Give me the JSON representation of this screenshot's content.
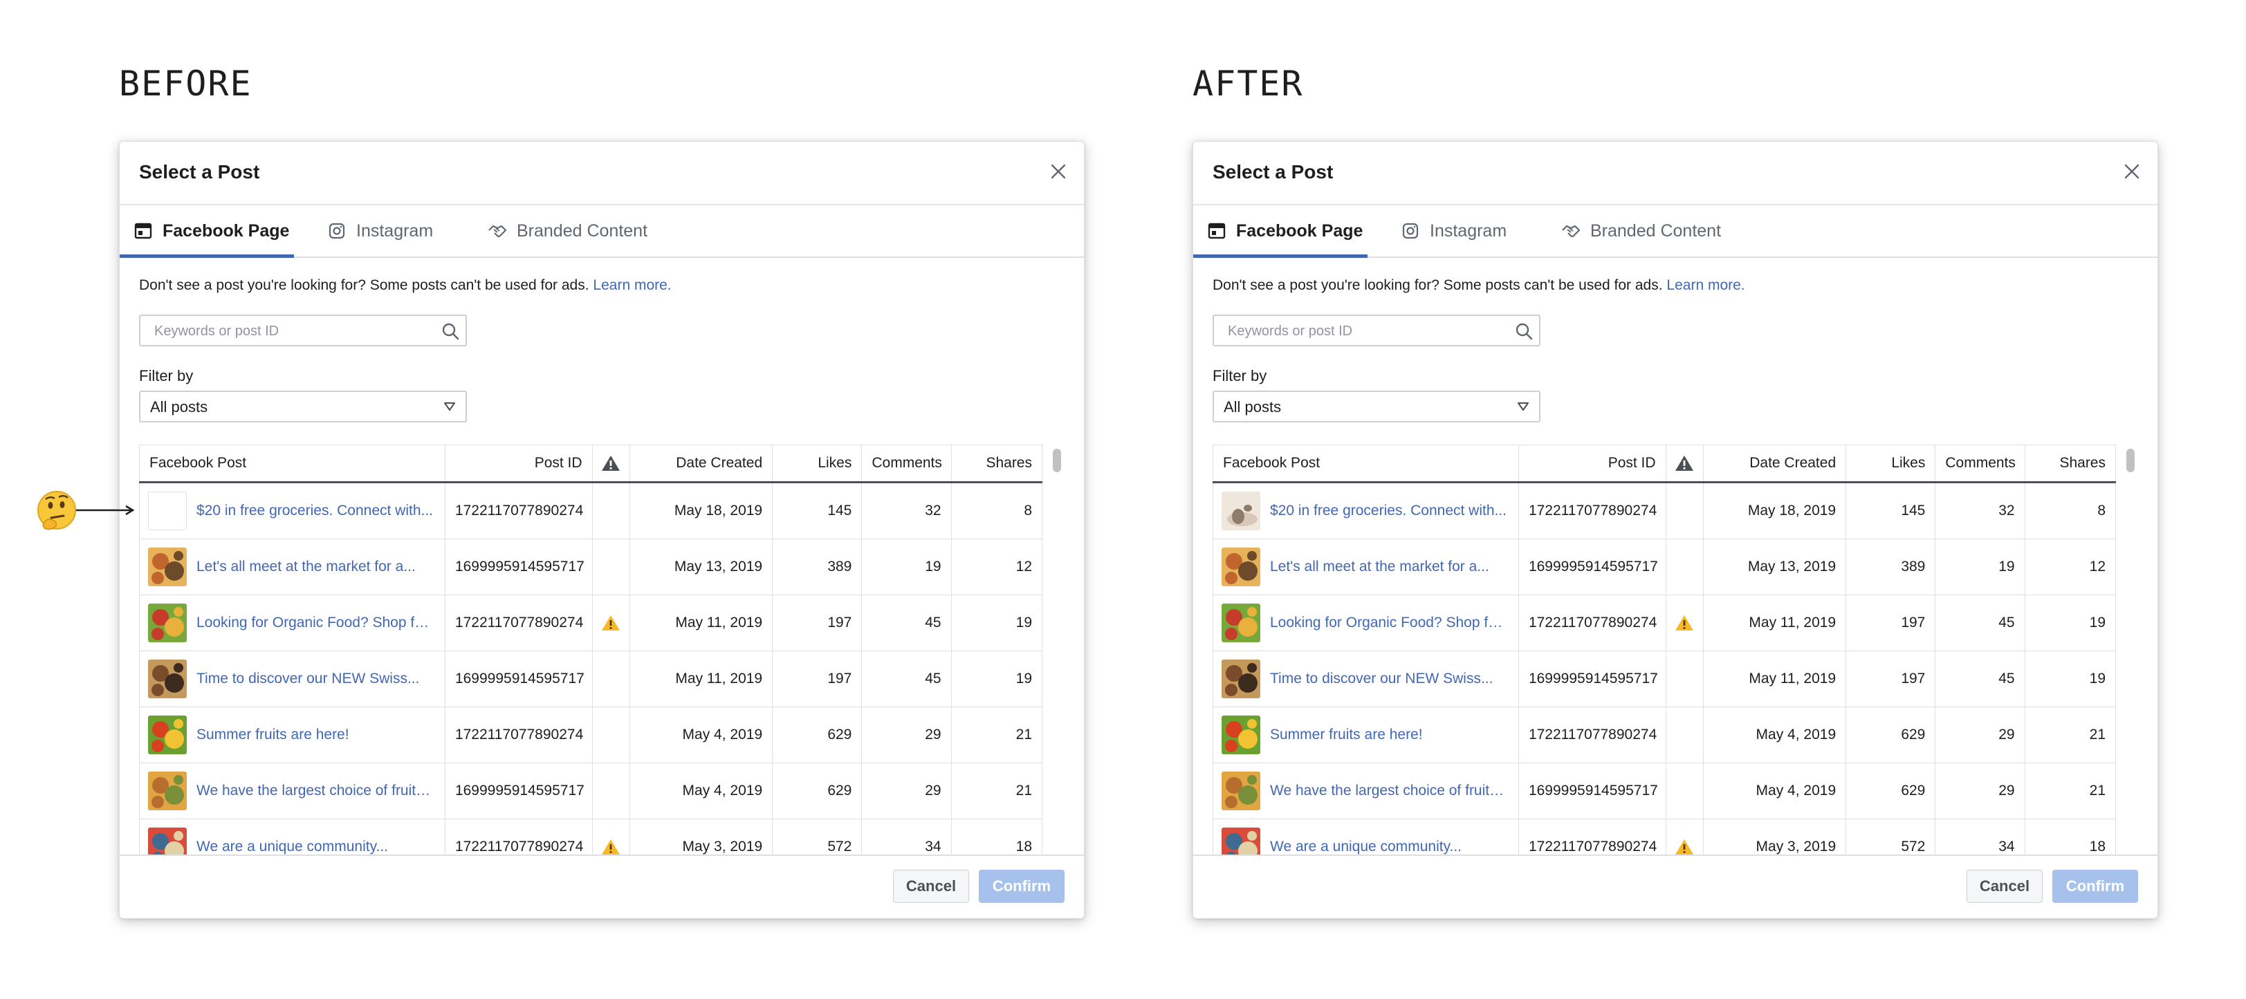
{
  "panels": [
    {
      "heading": "BEFORE",
      "first_thumb_loaded": false
    },
    {
      "heading": "AFTER",
      "first_thumb_loaded": true
    }
  ],
  "modal": {
    "title": "Select a Post",
    "tabs": [
      {
        "label": "Facebook Page",
        "icon": "facebook-page-icon",
        "active": true
      },
      {
        "label": "Instagram",
        "icon": "instagram-icon",
        "active": false
      },
      {
        "label": "Branded Content",
        "icon": "handshake-icon",
        "active": false
      }
    ],
    "notice_text": "Don't see a post you're looking for? Some posts can't be used for ads.",
    "notice_link": "Learn more.",
    "search_placeholder": "Keywords or post ID",
    "filter_label": "Filter by",
    "filter_value": "All posts",
    "columns": {
      "post": "Facebook Post",
      "post_id": "Post ID",
      "warning": "warning-icon",
      "date": "Date Created",
      "likes": "Likes",
      "comments": "Comments",
      "shares": "Shares"
    },
    "rows": [
      {
        "title": "$20 in free groceries. Connect with...",
        "post_id": "1722117077890274",
        "warning": false,
        "date": "May 18, 2019",
        "likes": "145",
        "comments": "32",
        "shares": "8"
      },
      {
        "title": "Let's all meet at the market for a...",
        "post_id": "1699995914595717",
        "warning": false,
        "date": "May 13, 2019",
        "likes": "389",
        "comments": "19",
        "shares": "12"
      },
      {
        "title": "Looking for Organic Food? Shop for...",
        "post_id": "1722117077890274",
        "warning": true,
        "date": "May 11, 2019",
        "likes": "197",
        "comments": "45",
        "shares": "19"
      },
      {
        "title": "Time to discover our NEW Swiss...",
        "post_id": "1699995914595717",
        "warning": false,
        "date": "May 11, 2019",
        "likes": "197",
        "comments": "45",
        "shares": "19"
      },
      {
        "title": "Summer fruits are here!",
        "post_id": "1722117077890274",
        "warning": false,
        "date": "May 4, 2019",
        "likes": "629",
        "comments": "29",
        "shares": "21"
      },
      {
        "title": "We have the largest choice of fruits...",
        "post_id": "1699995914595717",
        "warning": false,
        "date": "May 4, 2019",
        "likes": "629",
        "comments": "29",
        "shares": "21"
      },
      {
        "title": "We are a unique community...",
        "post_id": "1722117077890274",
        "warning": true,
        "date": "May 3, 2019",
        "likes": "572",
        "comments": "34",
        "shares": "18"
      }
    ],
    "cancel_label": "Cancel",
    "confirm_label": "Confirm"
  },
  "annotation": {
    "emoji": "🤔",
    "icon": "thinking-face-icon"
  },
  "colors": {
    "link": "#4267b2",
    "tab_underline": "#4267b2",
    "warning": "#f7b928",
    "confirm_disabled": "#a6c2ec",
    "border": "#dddfe2"
  }
}
